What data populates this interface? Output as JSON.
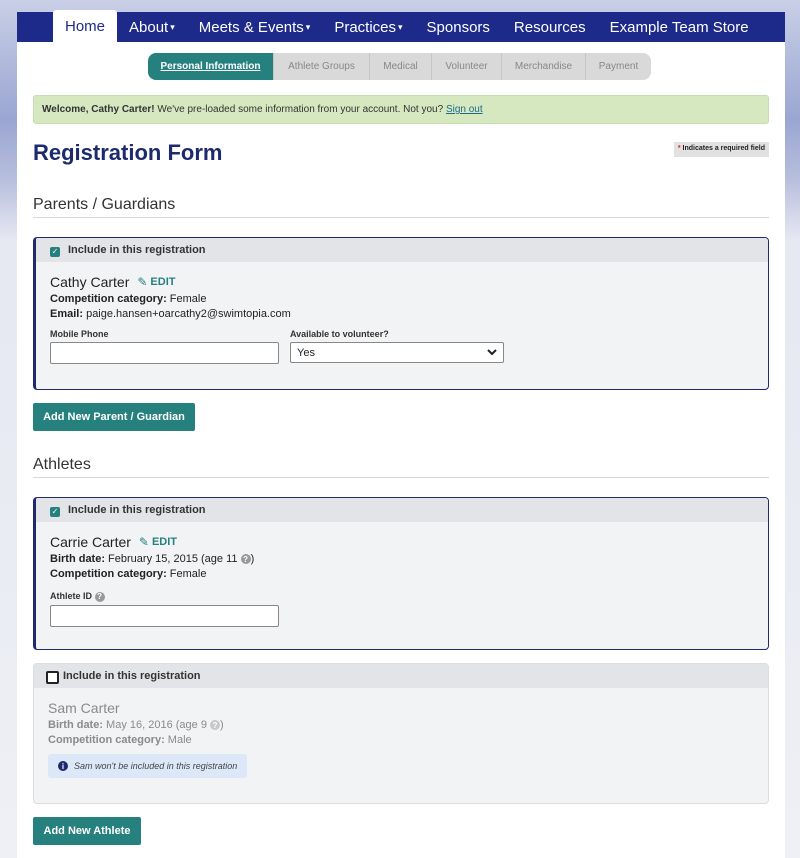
{
  "nav": {
    "items": [
      {
        "label": "Home",
        "caret": ""
      },
      {
        "label": "About",
        "caret": "▾"
      },
      {
        "label": "Meets & Events",
        "caret": "▾"
      },
      {
        "label": "Practices",
        "caret": "▾"
      },
      {
        "label": "Sponsors",
        "caret": ""
      },
      {
        "label": "Resources",
        "caret": ""
      },
      {
        "label": "Example Team Store",
        "caret": ""
      }
    ]
  },
  "steps": [
    "Personal Information",
    "Athlete Groups",
    "Medical",
    "Volunteer",
    "Merchandise",
    "Payment"
  ],
  "welcome": {
    "name": "Welcome, Cathy Carter!",
    "text": " We've pre-loaded some information from your account. Not you? ",
    "link": "Sign out"
  },
  "page_title": "Registration Form",
  "required_note": {
    "star": "*",
    "text": " Indicates a required field"
  },
  "parents": {
    "heading": "Parents / Guardians",
    "include_label": "Include in this registration",
    "name": "Cathy Carter",
    "edit_label": "EDIT",
    "category_label": "Competition category:",
    "category_value": " Female",
    "email_label": "Email:",
    "email_value": " paige.hansen+oarcathy2@swimtopia.com",
    "mobile_label": "Mobile Phone",
    "mobile_value": "",
    "volunteer_label": "Available to volunteer?",
    "volunteer_value": "Yes",
    "add_button": "Add New Parent / Guardian"
  },
  "athletes": {
    "heading": "Athletes",
    "list": [
      {
        "include_label": "Include in this registration",
        "name": "Carrie Carter",
        "edit_label": "EDIT",
        "birth_label": "Birth date:",
        "birth_value": " February 15, 2015 (age 11 ",
        "birth_close": ")",
        "category_label": "Competition category:",
        "category_value": " Female",
        "athlete_id_label": "Athlete ID",
        "athlete_id_value": ""
      },
      {
        "include_label": "Include in this registration",
        "name": "Sam Carter",
        "birth_label": "Birth date:",
        "birth_value": " May 16, 2016 (age 9 ",
        "birth_close": ")",
        "category_label": "Competition category:",
        "category_value": " Male",
        "note": "Sam won't be included in this registration"
      }
    ],
    "add_button": "Add New Athlete"
  },
  "colors": {
    "nav": "#1d2a8a",
    "accent": "#26807e",
    "welcome_bg": "#d5e8c0",
    "title": "#1d2a6e"
  }
}
